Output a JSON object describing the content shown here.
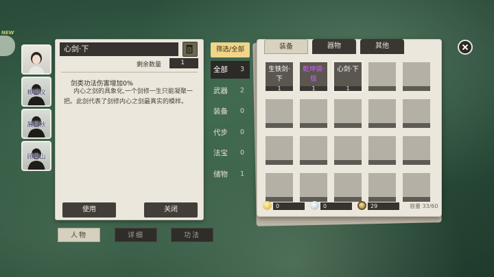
{
  "character_list": [
    {
      "name": "",
      "selected": true
    },
    {
      "name": "柳倾仪",
      "selected": false
    },
    {
      "name": "展星秋",
      "selected": false
    },
    {
      "name": "顾青山",
      "selected": false
    }
  ],
  "detail": {
    "item_name": "心剑·下",
    "quantity_label": "剩余数量",
    "quantity": "1",
    "effect": "剑类功法伤害增加0%",
    "description": "内心之剑的具象化,一个剑修一生只能凝聚一把。此剑代表了剑修内心之剑最真实的模样。",
    "use_label": "使用",
    "close_label": "关闭"
  },
  "bottom_tabs": [
    {
      "label": "人物",
      "active": true
    },
    {
      "label": "详细",
      "active": false
    },
    {
      "label": "功法",
      "active": false
    }
  ],
  "filter": {
    "header": "筛选/全部",
    "categories": [
      {
        "label": "全部",
        "count": "3",
        "active": true
      },
      {
        "label": "武器",
        "count": "2",
        "active": false
      },
      {
        "label": "装备",
        "count": "0",
        "active": false
      },
      {
        "label": "代步",
        "count": "0",
        "active": false
      },
      {
        "label": "法宝",
        "count": "0",
        "active": false
      },
      {
        "label": "储物",
        "count": "1",
        "active": false
      }
    ]
  },
  "inventory": {
    "tabs": [
      {
        "label": "装备",
        "active": true
      },
      {
        "label": "器物",
        "active": false
      },
      {
        "label": "其他",
        "active": false
      }
    ],
    "items": [
      {
        "name": "生铁剑·下",
        "qty": "1",
        "color": "#ffffff"
      },
      {
        "name": "乾坤袋·极",
        "qty": "1",
        "color": "#d45cff"
      },
      {
        "name": "心剑·下",
        "qty": "1",
        "color": "#ffffff"
      }
    ],
    "currencies": [
      {
        "icon": "gold-ingot-icon",
        "value": "0"
      },
      {
        "icon": "silver-ingot-icon",
        "value": "0"
      },
      {
        "icon": "copper-coin-icon",
        "value": "29"
      }
    ],
    "capacity": "容量 33/60"
  },
  "colors": {
    "filter_highlight": "#f0d58a",
    "rare_item": "#d45cff",
    "panel_bg": "#ece7dc"
  }
}
